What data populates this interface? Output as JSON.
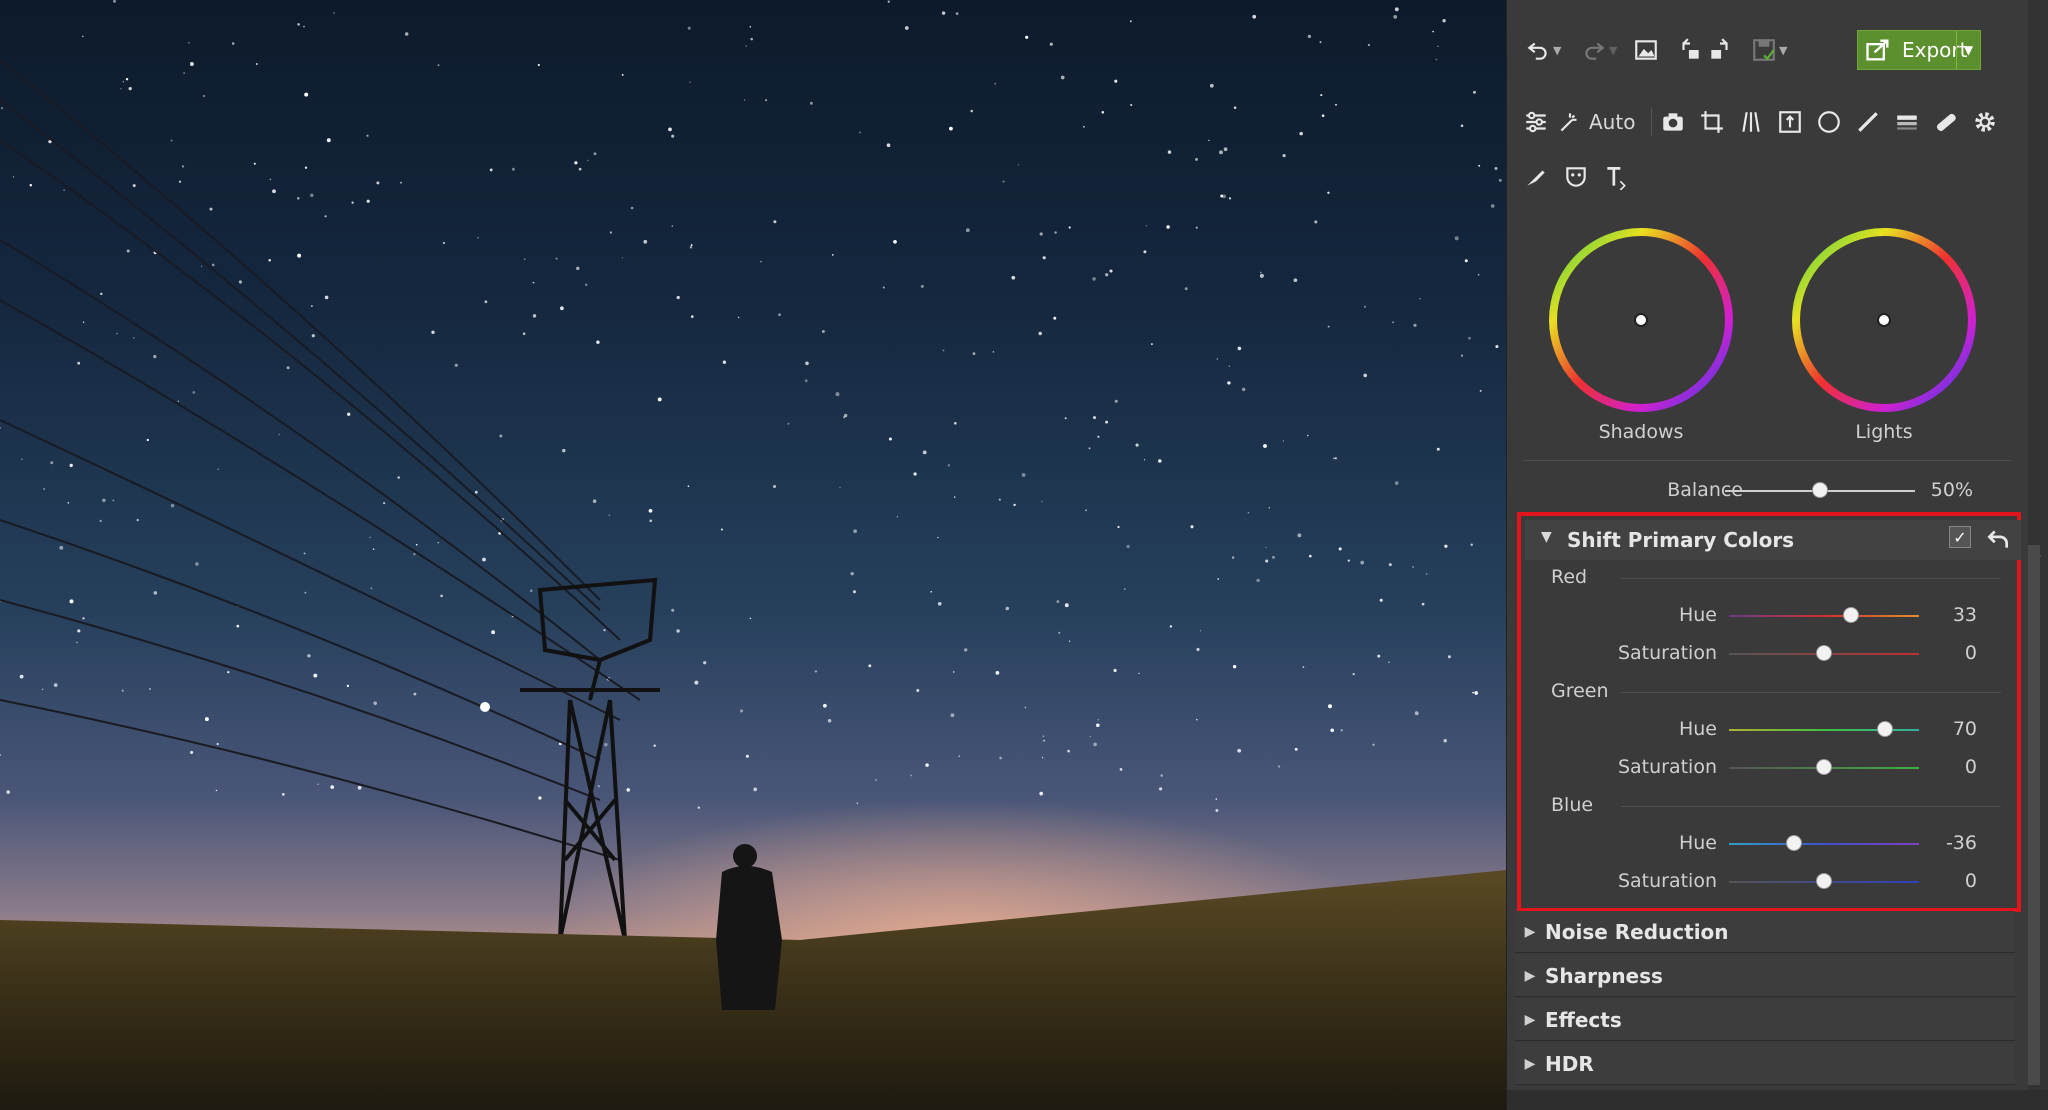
{
  "toolbar": {
    "export_label": "Export",
    "auto_label": "Auto"
  },
  "wheels": {
    "shadows_label": "Shadows",
    "lights_label": "Lights"
  },
  "balance": {
    "label": "Balance",
    "value": "50%",
    "level": 0.5
  },
  "shift_primary": {
    "title": "Shift Primary Colors",
    "groups": [
      {
        "name": "Red",
        "hue": {
          "label": "Hue",
          "value": "33",
          "level": 0.64
        },
        "saturation": {
          "label": "Saturation",
          "value": "0",
          "level": 0.5
        },
        "hue_gradient": [
          "#6a3a8a",
          "#d03030",
          "#e0902a"
        ],
        "sat_color": "#c03030"
      },
      {
        "name": "Green",
        "hue": {
          "label": "Hue",
          "value": "70",
          "level": 0.82
        },
        "saturation": {
          "label": "Saturation",
          "value": "0",
          "level": 0.5
        },
        "hue_gradient": [
          "#b0b030",
          "#40c040",
          "#30b0a0"
        ],
        "sat_color": "#40b040"
      },
      {
        "name": "Blue",
        "hue": {
          "label": "Hue",
          "value": "-36",
          "level": 0.34
        },
        "saturation": {
          "label": "Saturation",
          "value": "0",
          "level": 0.5
        },
        "hue_gradient": [
          "#30a0c0",
          "#4050d0",
          "#8040c0"
        ],
        "sat_color": "#3040c0"
      }
    ]
  },
  "sections": [
    "Noise Reduction",
    "Sharpness",
    "Effects",
    "HDR"
  ],
  "colors": {
    "highlight_border": "#e3141b",
    "export_bg": "#5c8f2e"
  }
}
